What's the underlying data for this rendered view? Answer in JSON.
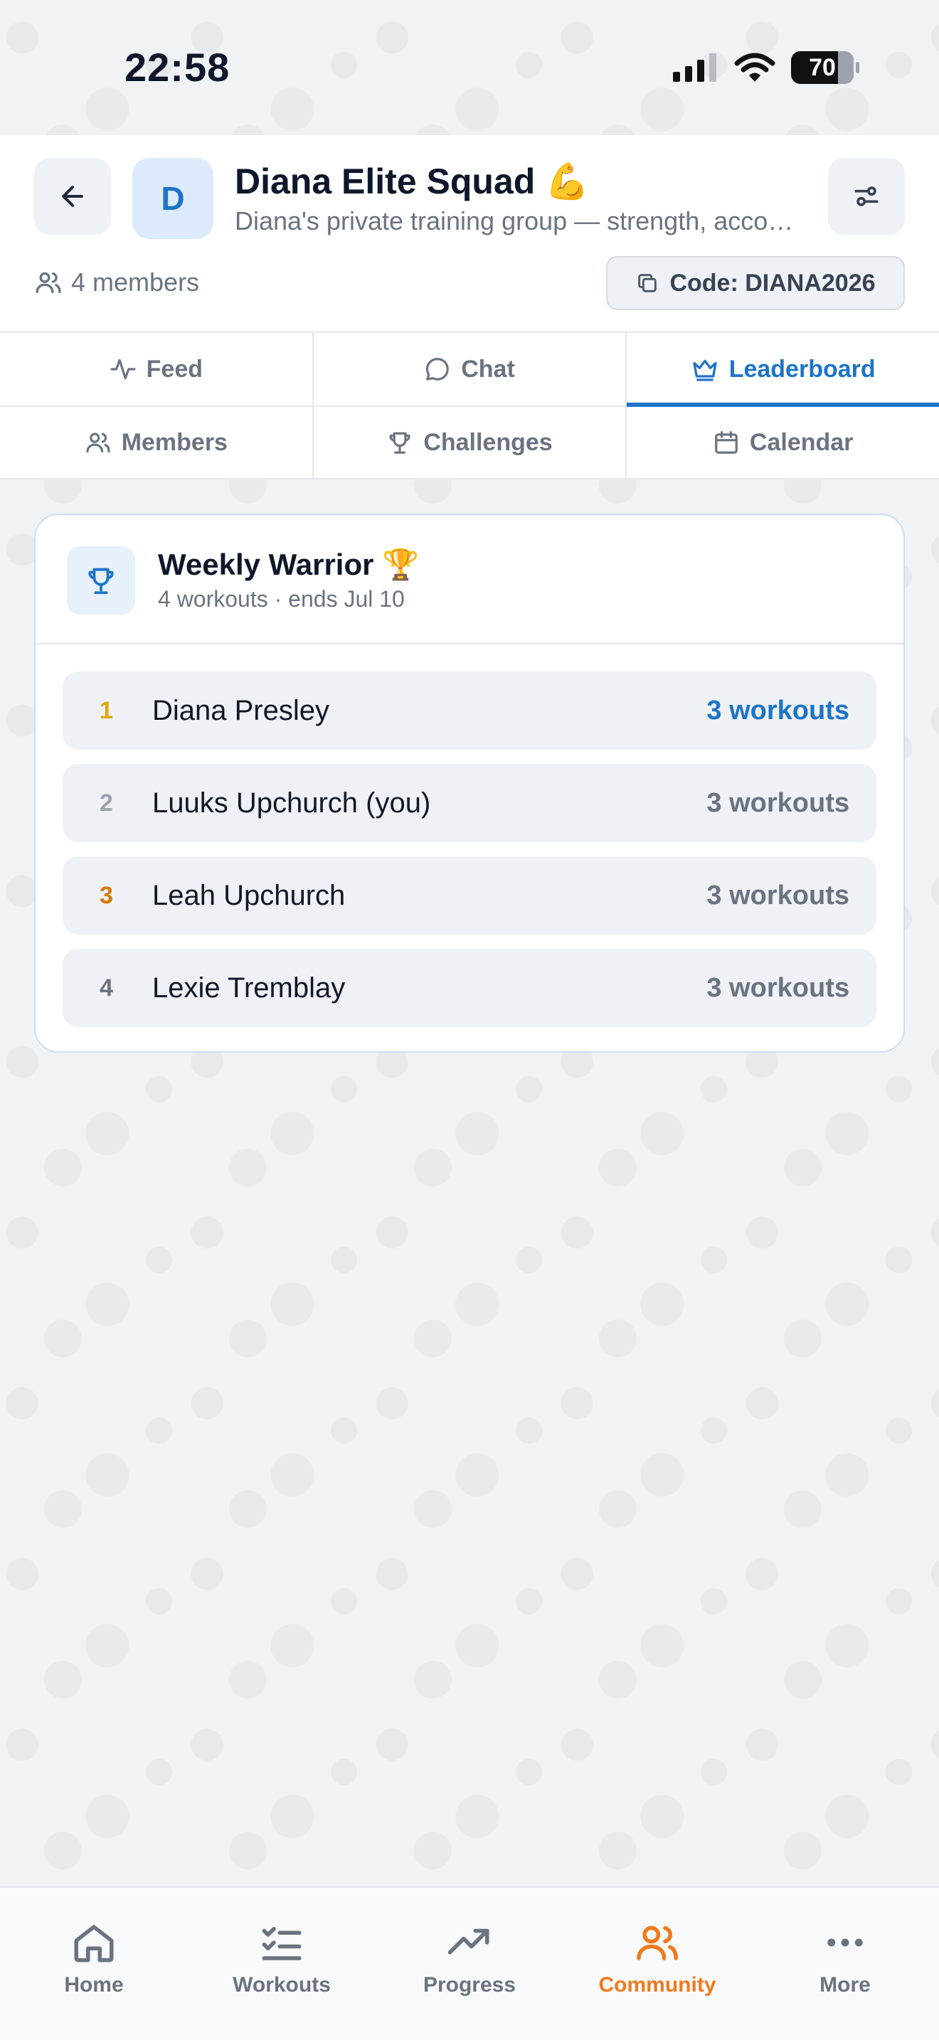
{
  "status_bar": {
    "time": "22:58",
    "battery": "70"
  },
  "header": {
    "avatar_letter": "D",
    "title": "Diana Elite Squad 💪",
    "description": "Diana's private training group — strength, accountability and progress together",
    "members_count": "4 members",
    "code": "Code: DIANA2026"
  },
  "tabs": {
    "row1": [
      {
        "label": "Feed",
        "icon": "activity-icon"
      },
      {
        "label": "Chat",
        "icon": "chat-bubble-icon"
      },
      {
        "label": "Leaderboard",
        "icon": "crown-icon",
        "active": true
      }
    ],
    "row2": [
      {
        "label": "Members",
        "icon": "users-icon"
      },
      {
        "label": "Challenges",
        "icon": "trophy-icon"
      },
      {
        "label": "Calendar",
        "icon": "calendar-icon"
      }
    ]
  },
  "leaderboard": {
    "title": "Weekly Warrior 🏆",
    "subtitle": "4 workouts · ends Jul 10",
    "rows": [
      {
        "rank": "1",
        "name": "Diana Presley",
        "score": "3 workouts",
        "rank_color": "#e5a50a",
        "score_color": "#1d74c8"
      },
      {
        "rank": "2",
        "name": "Luuks Upchurch  (you)",
        "score": "3 workouts",
        "rank_color": "#9ca3af",
        "score_color": "#6b7280"
      },
      {
        "rank": "3",
        "name": "Leah Upchurch",
        "score": "3 workouts",
        "rank_color": "#d97706",
        "score_color": "#6b7280"
      },
      {
        "rank": "4",
        "name": "Lexie Tremblay",
        "score": "3 workouts",
        "rank_color": "#6b7280",
        "score_color": "#6b7280"
      }
    ]
  },
  "bottom_nav": [
    {
      "label": "Home",
      "icon": "home-icon"
    },
    {
      "label": "Workouts",
      "icon": "checklist-icon"
    },
    {
      "label": "Progress",
      "icon": "trending-up-icon"
    },
    {
      "label": "Community",
      "icon": "community-icon",
      "active": true
    },
    {
      "label": "More",
      "icon": "more-dots-icon"
    }
  ],
  "colors": {
    "accent": "#1d74c8",
    "nav_active": "#f07a1d"
  }
}
